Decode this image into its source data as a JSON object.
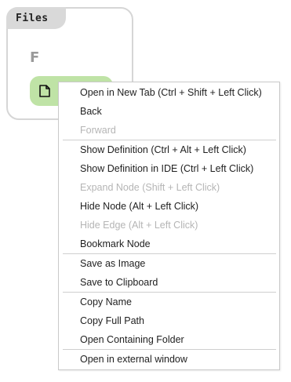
{
  "panel": {
    "tab_label": "Files",
    "folder_letter": "F"
  },
  "menu": {
    "items": [
      {
        "label": "Open in New Tab (Ctrl + Shift + Left Click)",
        "enabled": true
      },
      {
        "label": "Back",
        "enabled": true
      },
      {
        "label": "Forward",
        "enabled": false
      },
      {
        "label": "Show Definition (Ctrl + Alt + Left Click)",
        "enabled": true
      },
      {
        "label": "Show Definition in IDE (Ctrl + Left Click)",
        "enabled": true
      },
      {
        "label": "Expand Node (Shift + Left Click)",
        "enabled": false
      },
      {
        "label": "Hide Node (Alt + Left Click)",
        "enabled": true
      },
      {
        "label": "Hide Edge (Alt + Left Click)",
        "enabled": false
      },
      {
        "label": "Bookmark Node",
        "enabled": true
      },
      {
        "label": "Save as Image",
        "enabled": true
      },
      {
        "label": "Save to Clipboard",
        "enabled": true
      },
      {
        "label": "Copy Name",
        "enabled": true
      },
      {
        "label": "Copy Full Path",
        "enabled": true
      },
      {
        "label": "Open Containing Folder",
        "enabled": true
      },
      {
        "label": "Open in external window",
        "enabled": true
      }
    ]
  },
  "colors": {
    "node_fill": "#bfe3a6",
    "tab_fill": "#d9d9d9",
    "disabled_text": "#b5b5b5"
  },
  "icons": {
    "file_node_icon": "file-icon"
  }
}
